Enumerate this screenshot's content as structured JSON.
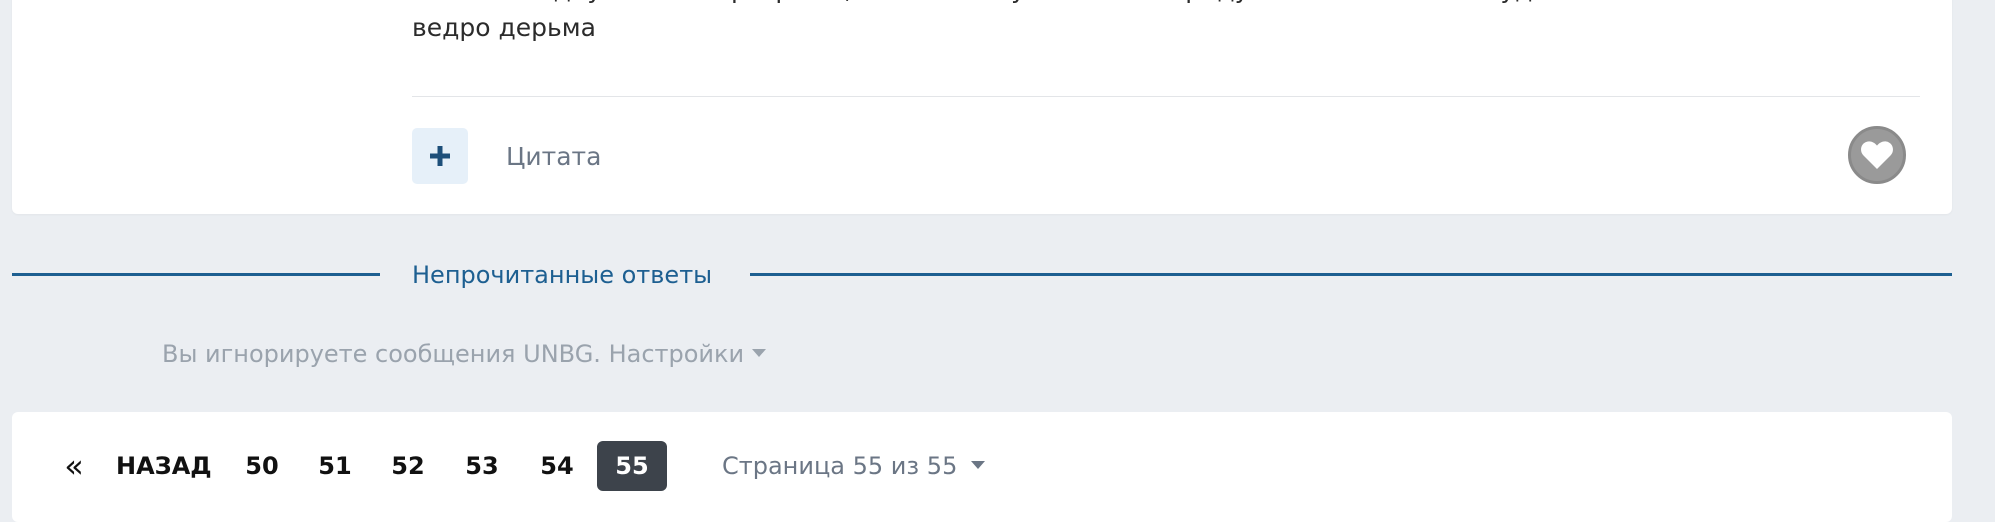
{
  "post": {
    "text_cut_line": "оставьте одну из этих программ, а то отстанутся кто-то придут слишком много будет",
    "text_last_line": "ведро дерьма",
    "quote_label": "Цитата"
  },
  "icons": {
    "multiquote": "plus-icon",
    "like": "heart-icon",
    "first_page": "double-chevron-left-icon",
    "dropdown": "caret-down-icon"
  },
  "colors": {
    "accent": "#1d5f91",
    "multiquote_bg": "#e6f0f9",
    "active_page_bg": "#3d434b",
    "like_bg": "#9a9a9a",
    "muted_text": "#9aa3ad",
    "page_background": "#ebeef2"
  },
  "unread_separator": {
    "label": "Непрочитанные ответы"
  },
  "ignore_notice": {
    "text": "Вы игнорируете сообщения UNBG.",
    "settings_label": "Настройки"
  },
  "pagination": {
    "first_symbol": "«",
    "prev_label": "НАЗАД",
    "pages": [
      "50",
      "51",
      "52",
      "53",
      "54",
      "55"
    ],
    "current_page": "55",
    "jump_label": "Страница 55 из 55"
  }
}
